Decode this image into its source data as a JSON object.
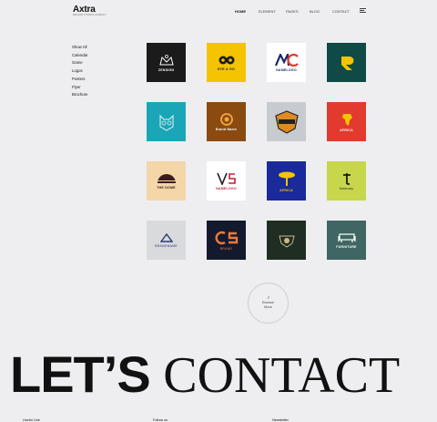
{
  "brand": {
    "name": "Axtra",
    "tagline": "DESIGN STUDIO AGENCY"
  },
  "nav": {
    "items": [
      "HOME",
      "ELEMENT",
      "PAGES",
      "BLOG",
      "CONTACT"
    ],
    "active": "HOME",
    "menu_icon": "hamburger-icon"
  },
  "filters": [
    "Show All",
    "Calendar",
    "Game",
    "Logos",
    "Posters",
    "Flyer",
    "Brochure"
  ],
  "tiles": [
    {
      "caption": "ZENSIGN",
      "bg": "#1b1b1b",
      "fg": "#ffffff"
    },
    {
      "caption": "EYE & GO",
      "bg": "#f5c400",
      "fg": "#1b1b1b"
    },
    {
      "caption": "NAMELOGO",
      "bg": "#ffffff",
      "fg": "#1b2a6b"
    },
    {
      "caption": "",
      "bg": "#0f4a47",
      "fg": "#f5c400"
    },
    {
      "caption": "",
      "bg": "#1aa6b7",
      "fg": "#e8f4f5"
    },
    {
      "caption": "Brand Name",
      "bg": "#8a4a10",
      "fg": "#ffffff"
    },
    {
      "caption": "",
      "bg": "#c7cbd0",
      "fg": "#222222"
    },
    {
      "caption": "AFRICA",
      "bg": "#e23a2e",
      "fg": "#ffffff"
    },
    {
      "caption": "THE DOME",
      "bg": "#f4d6a8",
      "fg": "#3a1c1c"
    },
    {
      "caption": "NAMELOGO",
      "bg": "#ffffff",
      "fg": "#c81e3c"
    },
    {
      "caption": "AFRICA",
      "bg": "#1a2a9a",
      "fg": "#f5c400"
    },
    {
      "caption": "timonary",
      "bg": "#c7d64a",
      "fg": "#1b1b1b"
    },
    {
      "caption": "BRANDNAME",
      "bg": "#d9dadc",
      "fg": "#2b3a7a"
    },
    {
      "caption": "BRAND",
      "bg": "#141a2e",
      "fg": "#ee7a3a"
    },
    {
      "caption": "",
      "bg": "#1f2d22",
      "fg": "#c8b88a"
    },
    {
      "caption": "FURNITURE",
      "bg": "#3f6662",
      "fg": "#ffffff"
    }
  ],
  "browse": {
    "line1": "Browse",
    "line2": "More",
    "icon": "arrow-icon"
  },
  "contact": {
    "word1": "LET’S",
    "word2": "CONTACT"
  },
  "footer": {
    "col1": "Useful Link",
    "col2": "Follow us",
    "col3": "Newsletter"
  }
}
